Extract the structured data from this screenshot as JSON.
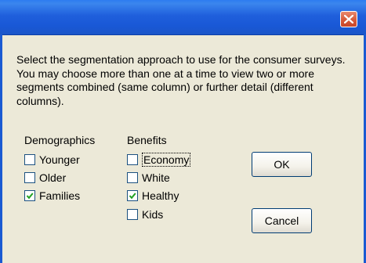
{
  "window": {
    "title": "",
    "close_icon": "close-icon"
  },
  "instructions": "Select the segmentation approach to use for the consumer surveys.  You may choose more than one at a time to view two or more segments combined (same column) or further detail (different columns).",
  "demographics": {
    "label": "Demographics",
    "options": [
      {
        "label": "Younger",
        "checked": false
      },
      {
        "label": "Older",
        "checked": false
      },
      {
        "label": "Families",
        "checked": true
      }
    ]
  },
  "benefits": {
    "label": "Benefits",
    "options": [
      {
        "label": "Economy",
        "checked": false
      },
      {
        "label": "White",
        "checked": false
      },
      {
        "label": "Healthy",
        "checked": true
      },
      {
        "label": "Kids",
        "checked": false
      }
    ]
  },
  "buttons": {
    "ok": "OK",
    "cancel": "Cancel"
  },
  "colors": {
    "titlebar": "#1f5fdc",
    "close_button": "#d75a3a",
    "dialog_background": "#ece9d8",
    "button_border": "#003c74"
  }
}
